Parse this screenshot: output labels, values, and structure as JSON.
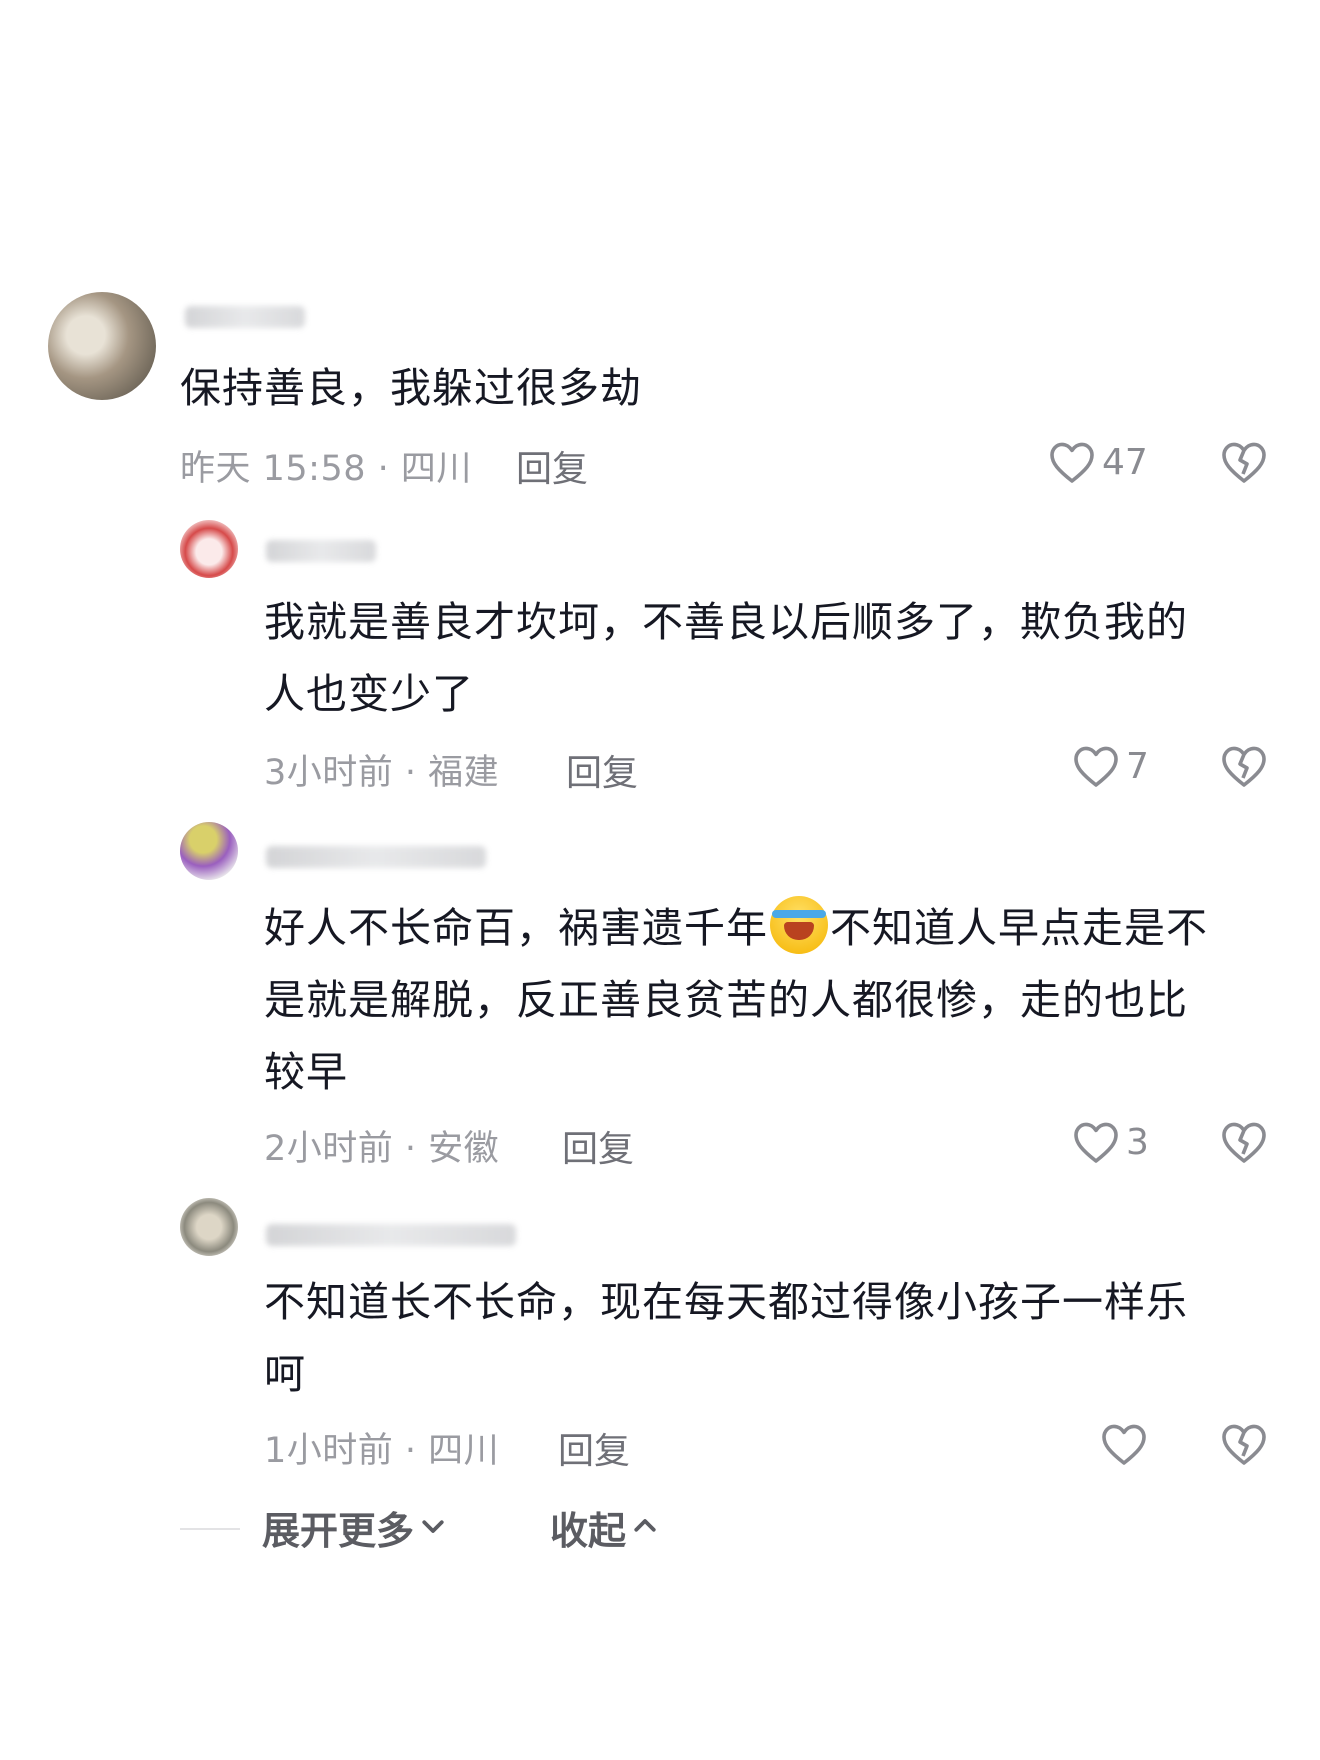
{
  "comments": [
    {
      "text": "保持善良，我躲过很多劫",
      "time_location": "昨天 15:58 · 四川",
      "reply_label": "回复",
      "likes": "47"
    },
    {
      "text_line1": "我就是善良才坎坷，不善良以后顺多了，欺负我的",
      "text_line2": "人也变少了",
      "time_location": "3小时前 · 福建",
      "reply_label": "回复",
      "likes": "7"
    },
    {
      "text_line1a": "好人不长命百，祸害遗千年",
      "text_line1b": "不知道人早点走是不",
      "text_line2": "是就是解脱，反正善良贫苦的人都很惨，走的也比",
      "text_line3": "较早",
      "emoji_name": "laughing-crying-emoji",
      "time_location": "2小时前 · 安徽",
      "reply_label": "回复",
      "likes": "3"
    },
    {
      "text_line1": "不知道长不长命，现在每天都过得像小孩子一样乐",
      "text_line2": "呵",
      "time_location": "1小时前 · 四川",
      "reply_label": "回复",
      "likes": ""
    }
  ],
  "footer": {
    "expand_label": "展开更多",
    "collapse_label": "收起"
  },
  "icons": {
    "like": "heart-outline-icon",
    "dislike": "broken-heart-icon",
    "expand": "chevron-down-icon",
    "collapse": "chevron-up-icon"
  }
}
